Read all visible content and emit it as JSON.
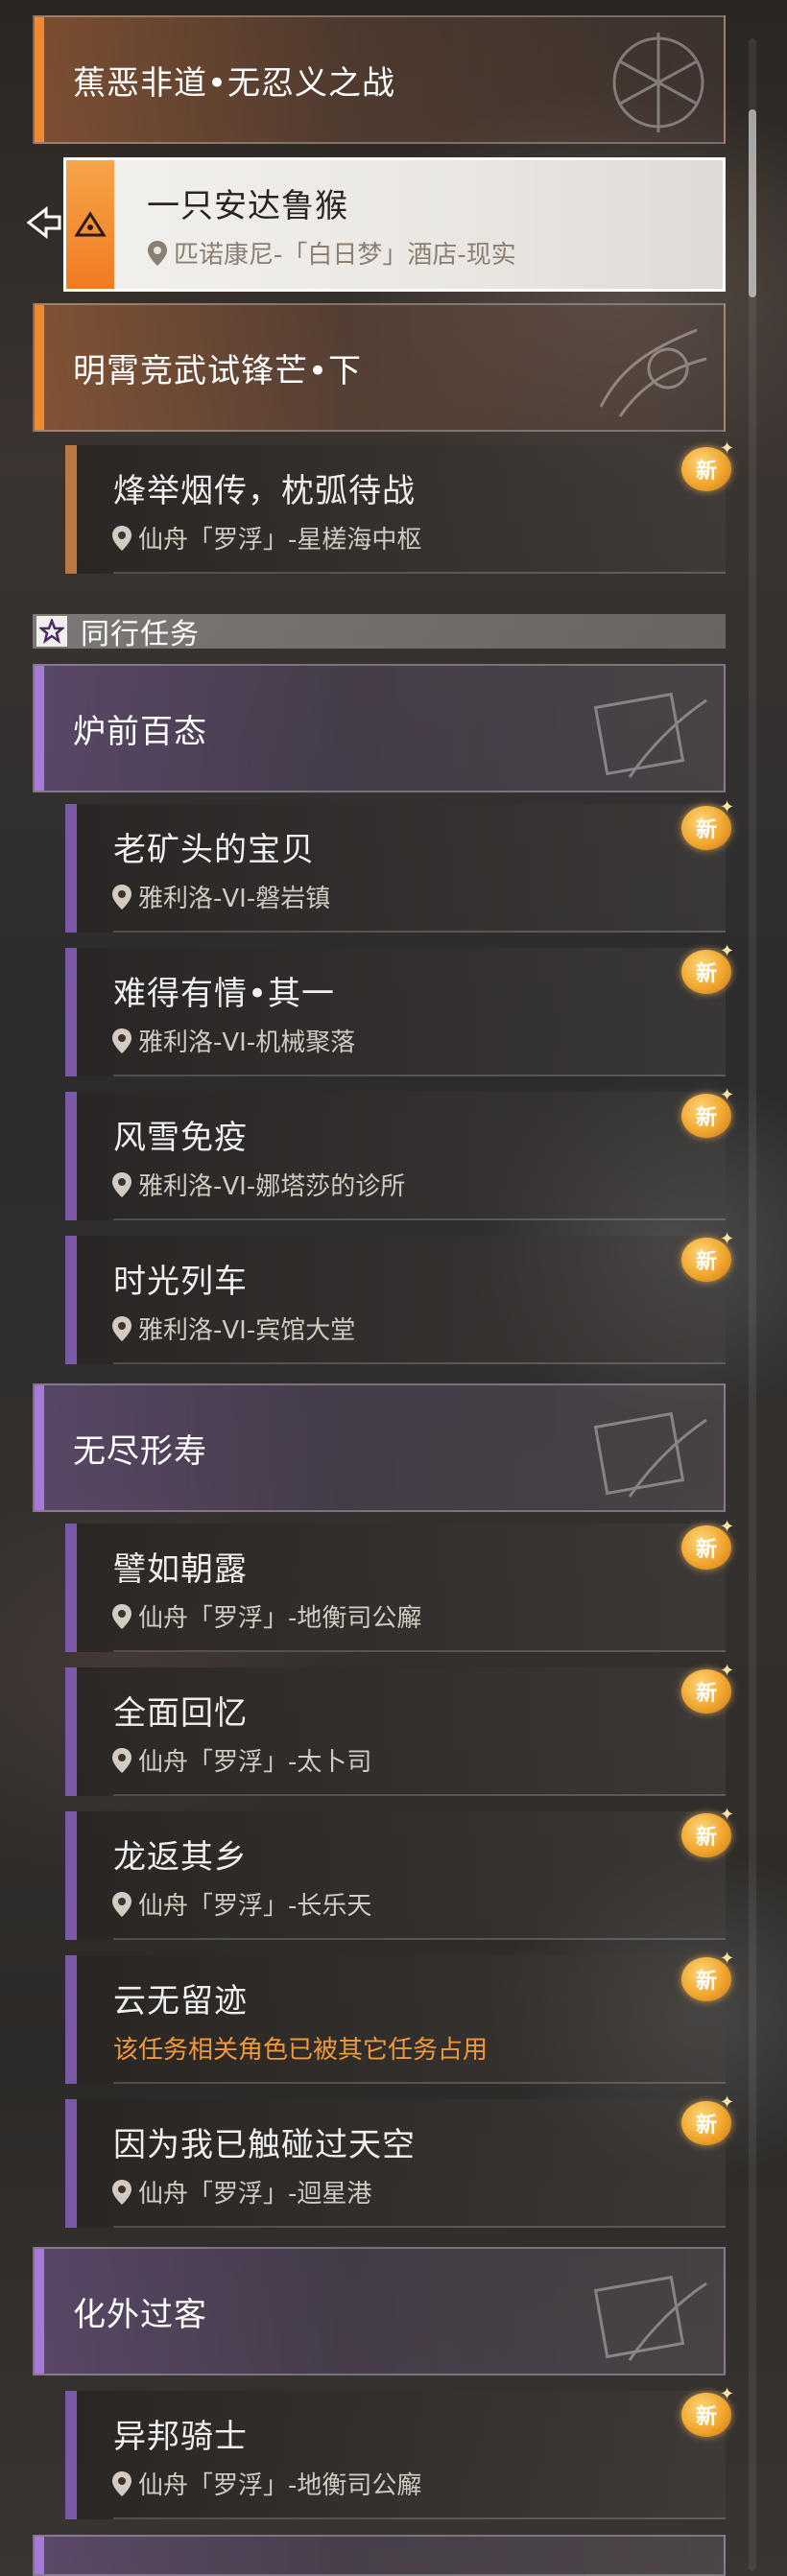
{
  "main_story": {
    "chapter1": {
      "title": "蕉恶非道•无忍义之战"
    },
    "selected_quest": {
      "name": "一只安达鲁猴",
      "location": "匹诺康尼-「白日梦」酒店-现实"
    },
    "chapter2": {
      "title": "明霄竞武试锋芒•下"
    },
    "quest_a": {
      "name": "烽举烟传，枕弧待战",
      "location": "仙舟「罗浮」-星槎海中枢",
      "badge": "新"
    }
  },
  "companion_section": {
    "title": "同行任务",
    "groups": [
      {
        "title": "炉前百态",
        "quests": [
          {
            "name": "老矿头的宝贝",
            "location": "雅利洛-VI-磐岩镇",
            "badge": "新"
          },
          {
            "name": "难得有情•其一",
            "location": "雅利洛-VI-机械聚落",
            "badge": "新"
          },
          {
            "name": "风雪免疫",
            "location": "雅利洛-VI-娜塔莎的诊所",
            "badge": "新"
          },
          {
            "name": "时光列车",
            "location": "雅利洛-VI-宾馆大堂",
            "badge": "新"
          }
        ]
      },
      {
        "title": "无尽形寿",
        "quests": [
          {
            "name": "譬如朝露",
            "location": "仙舟「罗浮」-地衡司公廨",
            "badge": "新"
          },
          {
            "name": "全面回忆",
            "location": "仙舟「罗浮」-太卜司",
            "badge": "新"
          },
          {
            "name": "龙返其乡",
            "location": "仙舟「罗浮」-长乐天",
            "badge": "新"
          },
          {
            "name": "云无留迹",
            "location": "该任务相关角色已被其它任务占用",
            "badge": "新"
          },
          {
            "name": "因为我已触碰过天空",
            "location": "仙舟「罗浮」-迴星港",
            "badge": "新"
          }
        ]
      },
      {
        "title": "化外过客",
        "quests": [
          {
            "name": "异邦骑士",
            "location": "仙舟「罗浮」-地衡司公廨",
            "badge": "新"
          }
        ]
      }
    ]
  },
  "colors": {
    "orange_accent": "#f08a2e",
    "purple_accent": "#a77ad8",
    "warning_text": "#f29a3a",
    "badge": "#f0a62e"
  },
  "icons": {
    "location": "location-pin-icon",
    "new_badge": "new-badge-icon",
    "section": "star-icon",
    "selected": "triangle-quest-icon",
    "pointer": "arrow-pointer-icon"
  }
}
